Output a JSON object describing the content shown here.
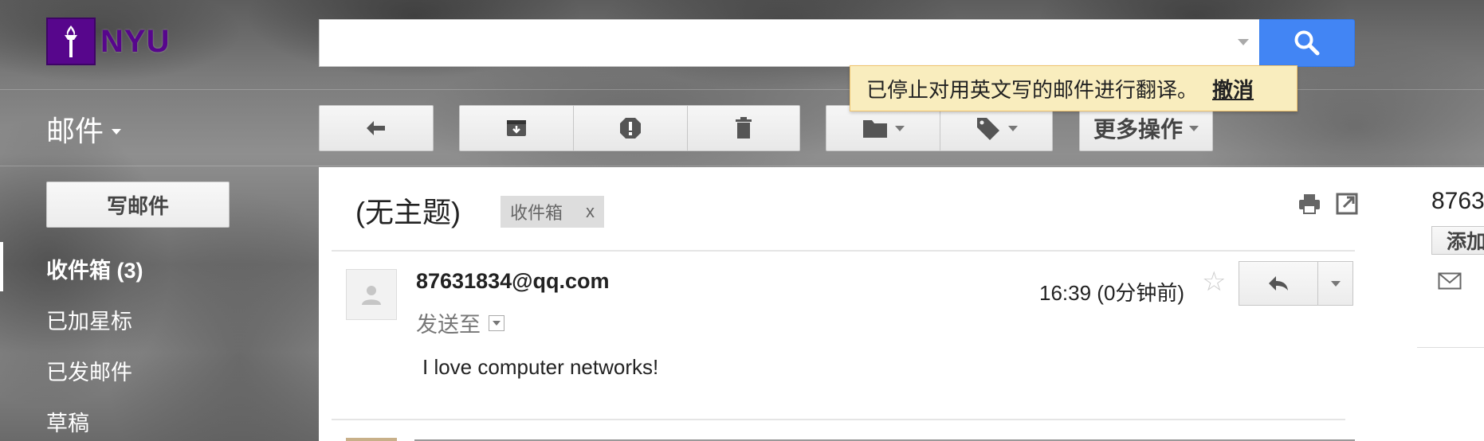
{
  "header": {
    "logo_text": "NYU",
    "search": {
      "value": "",
      "placeholder": ""
    }
  },
  "mail_label": "邮件",
  "toolbar": {
    "buttons": [
      "back-arrow-icon",
      "archive-icon",
      "report-spam-icon",
      "delete-icon",
      "folder-icon",
      "tag-icon"
    ],
    "more_label": "更多操作"
  },
  "notice": {
    "message": "已停止对用英文写的邮件进行翻译。",
    "undo": "撤消"
  },
  "sidebar": {
    "compose": "写邮件",
    "items": [
      {
        "label": "收件箱 (3)",
        "active": true
      },
      {
        "label": "已加星标"
      },
      {
        "label": "已发邮件"
      },
      {
        "label": "草稿"
      }
    ]
  },
  "email": {
    "subject": "(无主题)",
    "label_chip": "收件箱",
    "label_remove": "x",
    "sender": "87631834@qq.com",
    "send_to": "发送至",
    "time": "16:39 (0分钟前)",
    "body": "I love computer networks!"
  },
  "right_panel": {
    "contact_partial": "8763",
    "add_button_partial": "添加"
  },
  "colors": {
    "nyu_purple": "#57068c",
    "search_blue": "#4285f4",
    "notice_bg": "#f9edbe"
  }
}
